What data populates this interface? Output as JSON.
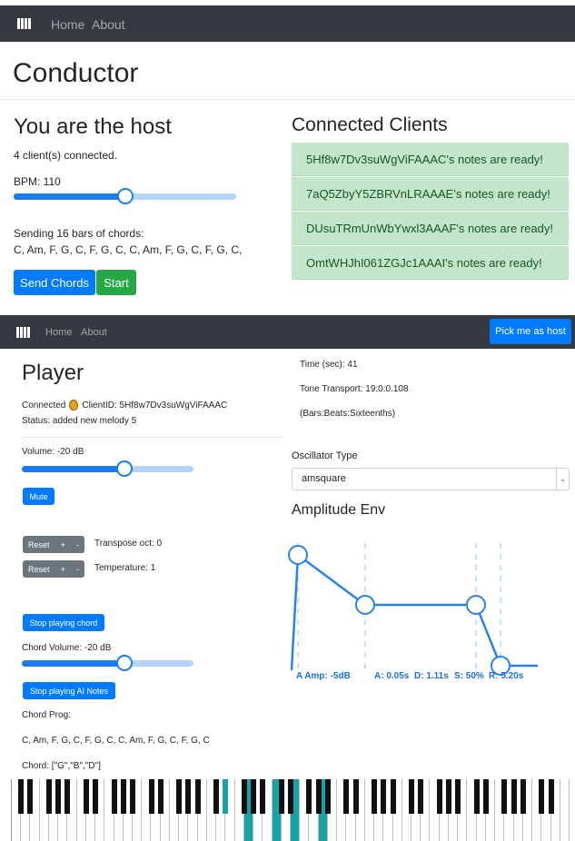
{
  "host_nav": {
    "home": "Home",
    "about": "About",
    "logo_icon": "piano-icon"
  },
  "host_title": "Conductor",
  "host": {
    "heading": "You are the host",
    "clients_connected": "4 client(s) connected.",
    "bpm_label": "BPM: 110",
    "bpm_fraction": 0.5,
    "sending_label": "Sending 16 bars of chords:",
    "chords": "C, Am, F, G, C, F, G, C, C, Am, F, G, C, F, G, C,",
    "send_button": "Send Chords",
    "start_button": "Start"
  },
  "clients": {
    "heading": "Connected Clients",
    "items": [
      "5Hf8w7Dv3suWgViFAAAC's notes are ready!",
      "7aQ5ZbyY5ZBRVnLRAAAE's notes are ready!",
      "DUsuTRmUnWbYwxl3AAAF's notes are ready!",
      "OmtWHJhI061ZGJc1AAAI's notes are ready!"
    ]
  },
  "player_nav": {
    "home": "Home",
    "about": "About",
    "pick_host": "Pick me as host",
    "logo_icon": "piano-icon"
  },
  "player": {
    "heading": "Player",
    "connected_label": "Connected",
    "connected_icon": "money-bag-icon",
    "client_id": "ClientID: 5Hf8w7Dv3suWgViFAAAC",
    "status": "Status: added new melody 5",
    "volume_label": "Volume: -20 dB",
    "volume_fraction": 0.6,
    "mute_button": "Mute",
    "reset1": "Reset",
    "plus1": "+",
    "minus1": "-",
    "transpose_label": "Transpose oct: 0",
    "reset2": "Reset",
    "plus2": "+",
    "minus2": "-",
    "temperature_label": "Temperature: 1",
    "stop_chord_button": "Stop playing chord",
    "chord_volume_label": "Chord Volume: -20 dB",
    "chord_volume_fraction": 0.6,
    "stop_ai_button": "Stop playing AI Notes",
    "chord_prog_label": "Chord Prog:",
    "chord_prog": "C, Am, F, G, C, F, G, C, C, Am, F, G, C, F, G, C",
    "chord_label": "Chord: [\"G\",\"B\",\"D\"]"
  },
  "timing": {
    "time": "Time (sec): 41",
    "transport": "Tone Transport: 19:0:0.108",
    "format": "(Bars:Beats:Sixteenths)"
  },
  "oscillator": {
    "label": "Oscillator Type",
    "value": "amsquare"
  },
  "envelope": {
    "heading": "Amplitude Env",
    "a_amp": "A Amp: -5dB",
    "attack": "A: 0.05s",
    "decay": "D: 1.11s",
    "sustain": "S: 50%",
    "release": "R: 5.20s",
    "attack_seconds": 0.05,
    "decay_seconds": 1.11,
    "sustain_fraction": 0.5,
    "release_seconds": 5.2
  },
  "piano": {
    "white_key_count": 60,
    "highlight_color": "#17a2a6",
    "key_color_black": "#111111"
  },
  "colors": {
    "primary": "#007bff",
    "success": "#28a745",
    "navbar": "#343a40",
    "client_bg": "#c3e6cb",
    "client_text": "#155724"
  }
}
